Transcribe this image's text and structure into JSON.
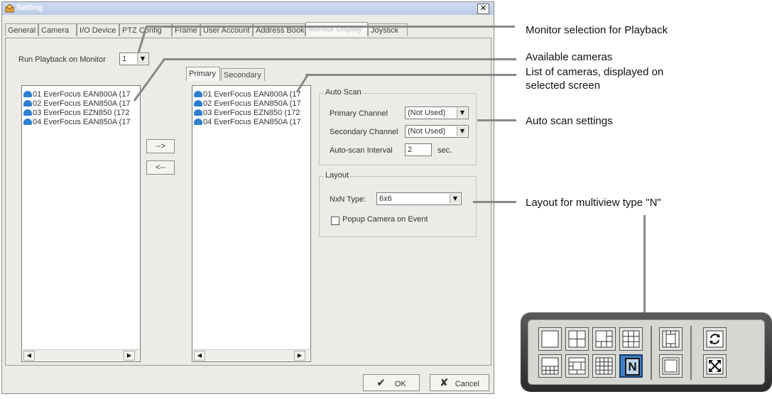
{
  "dialog": {
    "title": "Setting",
    "close_symbol": "✕",
    "tabs": [
      "General",
      "Camera",
      "I/O Device",
      "PTZ Config",
      "Frame",
      "User Account",
      "Address Book",
      "Monitor Display",
      "Joystick"
    ],
    "active_tab": "Monitor Display",
    "run_playback_label": "Run Playback on Monitor",
    "run_playback_value": "1",
    "available_cameras": [
      "01 EverFocus EAN800A (17",
      "02 EverFocus EAN850A (17",
      "03 EverFocus EZN850 (172",
      "04 EverFocus EAN850A (17"
    ],
    "move_right_label": "-->",
    "move_left_label": "<--",
    "screen_tabs": [
      "Primary",
      "Secondary"
    ],
    "active_screen_tab": "Primary",
    "screen_cameras": [
      "01 EverFocus EAN800A (17",
      "02 EverFocus EAN850A (17",
      "03 EverFocus EZN850 (172",
      "04 EverFocus EAN850A (17"
    ],
    "auto_scan": {
      "title": "Auto Scan",
      "primary_channel_label": "Primary Channel",
      "primary_channel_value": "(Not Used)",
      "secondary_channel_label": "Secondary Channel",
      "secondary_channel_value": "(Not Used)",
      "interval_label": "Auto-scan Interval",
      "interval_value": "2",
      "interval_unit": "sec."
    },
    "layout": {
      "title": "Layout",
      "nxn_label": "NxN Type:",
      "nxn_value": "6x6",
      "popup_label": "Popup Camera on Event",
      "popup_checked": false
    },
    "ok_label": "OK",
    "cancel_label": "Cancel",
    "icons": {
      "ok": "checkmark-icon",
      "cancel": "x-icon",
      "camera": "camera-icon",
      "title": "settings-icon"
    }
  },
  "annotations": {
    "monitor_selection": "Monitor selection for Playback",
    "available_cameras": "Available cameras",
    "list_cameras_line1": "List of cameras, displayed on",
    "list_cameras_line2": "selected screen",
    "auto_scan": "Auto scan settings",
    "layout_n": "Layout for multiview type \"N\""
  },
  "layout_panel": {
    "selected_button": "N",
    "n_label": "N",
    "accent": "#3d82c7"
  }
}
